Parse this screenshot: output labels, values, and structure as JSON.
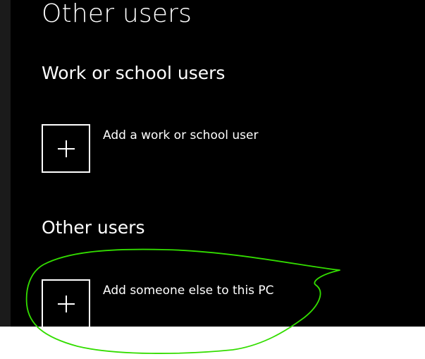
{
  "page": {
    "title": "Other users"
  },
  "work_school": {
    "heading": "Work or school users",
    "add_label": "Add a work or school user",
    "icon": "plus-icon"
  },
  "other_users": {
    "heading": "Other users",
    "add_label": "Add someone else to this PC",
    "icon": "plus-icon"
  },
  "annotation": {
    "color": "#33dd00",
    "shape": "hand-drawn ellipse"
  },
  "colors": {
    "background": "#000000",
    "text": "#ffffff",
    "side_strip": "#1b1b1b"
  }
}
